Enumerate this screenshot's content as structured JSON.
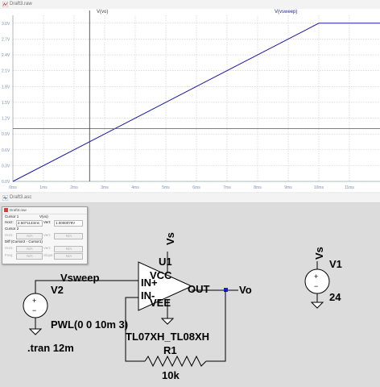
{
  "plot_window": {
    "title": "Draft3.raw",
    "traces": {
      "vo_label": "V(vo)",
      "vsweep_label": "V(vsweep)"
    },
    "trace_colors": {
      "vo": "#555555",
      "vsweep": "#1a1aa6",
      "grid": "#c8c8c8"
    },
    "y_ticks": [
      "3.0V",
      "2.7V",
      "2.4V",
      "2.1V",
      "1.8V",
      "1.5V",
      "1.2V",
      "0.9V",
      "0.6V",
      "0.3V",
      "0.0V"
    ],
    "x_ticks": [
      "0ms",
      "1ms",
      "2ms",
      "3ms",
      "4ms",
      "5ms",
      "6ms",
      "7ms",
      "8ms",
      "9ms",
      "10ms",
      "11ms"
    ]
  },
  "chart_data": {
    "type": "line",
    "series": [
      {
        "name": "V(vsweep)",
        "x": [
          0,
          10,
          12
        ],
        "y": [
          0,
          3,
          3
        ]
      },
      {
        "name": "V(vo)",
        "x": [
          0,
          12
        ],
        "y": [
          1.0,
          1.0
        ]
      }
    ],
    "xlim": [
      0,
      12
    ],
    "ylim": [
      0,
      3.15
    ],
    "x_unit": "ms",
    "y_unit": "V",
    "grid": true,
    "cursor_x": 2.5071
  },
  "schematic_window": {
    "title": "Draft3.asc"
  },
  "cursor_dialog": {
    "title": "Draft3.raw",
    "trace": "V(vo)",
    "cursor1_label": "Cursor 1",
    "horz_label": "Horz:",
    "horz_value": "2.5071143ms",
    "vert_label": "Vert:",
    "vert_value": "1.0000078V",
    "cursor2_label": "Cursor 2",
    "na": "N/A",
    "diff_label": "Diff (Cursor2 - Cursor1)",
    "freq_label": "Freq:",
    "slope_label": "Slope:"
  },
  "schematic": {
    "opamp_ref": "U1",
    "opamp_pin_vcc": "VCC",
    "opamp_pin_inp": "IN+",
    "opamp_pin_inn": "IN-",
    "opamp_pin_vee": "VEE",
    "opamp_pin_out": "OUT",
    "opamp_model": "TL07XH_TL08XH",
    "net_vs_left": "Vs",
    "net_vs_right": "Vs",
    "net_vsweep": "Vsweep",
    "net_vo": "Vo",
    "v2_ref": "V2",
    "v2_value": "PWL(0 0 10m 3)",
    "v1_ref": "V1",
    "v1_value": "24",
    "r1_ref": "R1",
    "r1_value": "10k",
    "directive": ".tran 12m"
  }
}
